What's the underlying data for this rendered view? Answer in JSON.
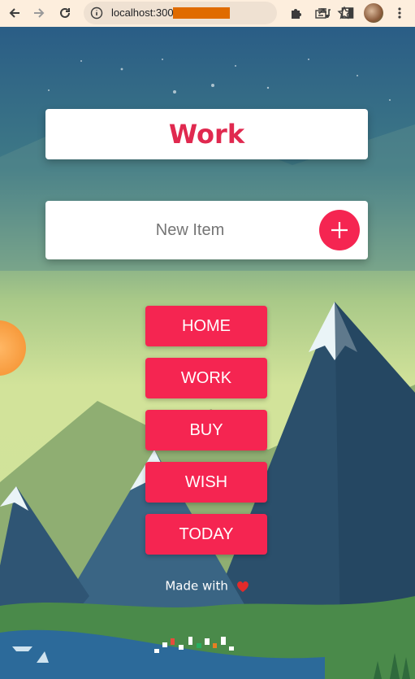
{
  "browser": {
    "url": "localhost:3000/work",
    "url_visible": "localhost:3000/work"
  },
  "page": {
    "title": "Work",
    "input_placeholder": "New Item",
    "nav_buttons": [
      "HOME",
      "WORK",
      "BUY",
      "WISH",
      "TODAY"
    ],
    "footer_text": "Made with"
  },
  "colors": {
    "accent": "#f52551",
    "title": "#e0294f",
    "chrome": "#fdeedd"
  }
}
